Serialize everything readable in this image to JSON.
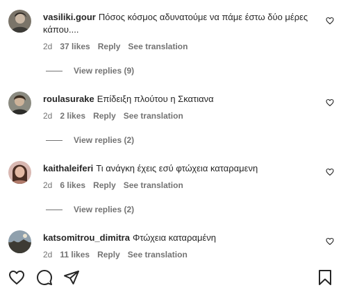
{
  "comments": [
    {
      "username": "vasiliki.gour",
      "text": "Πόσος κόσμος αδυνατούμε να πάμε έστω δύο μέρες κάπου....",
      "time": "2d",
      "likes": "37 likes",
      "reply_label": "Reply",
      "translation_label": "See translation",
      "view_replies": "View replies (9)"
    },
    {
      "username": "roulasurake",
      "text": "Επίδειξη πλούτου η Σκατιανα",
      "time": "2d",
      "likes": "2 likes",
      "reply_label": "Reply",
      "translation_label": "See translation",
      "view_replies": "View replies (2)"
    },
    {
      "username": "kaithaleiferi",
      "text": "Τι ανάγκη έχεις εσύ φτώχεια καταραμενη",
      "time": "2d",
      "likes": "6 likes",
      "reply_label": "Reply",
      "translation_label": "See translation",
      "view_replies": "View replies (2)"
    },
    {
      "username": "katsomitrou_dimitra",
      "text": "Φτώχεια καταραμένη",
      "time": "2d",
      "likes": "11 likes",
      "reply_label": "Reply",
      "translation_label": "See translation"
    }
  ],
  "icons": {
    "like": "heart-icon",
    "comment": "comment-icon",
    "share": "send-icon",
    "save": "bookmark-icon"
  }
}
